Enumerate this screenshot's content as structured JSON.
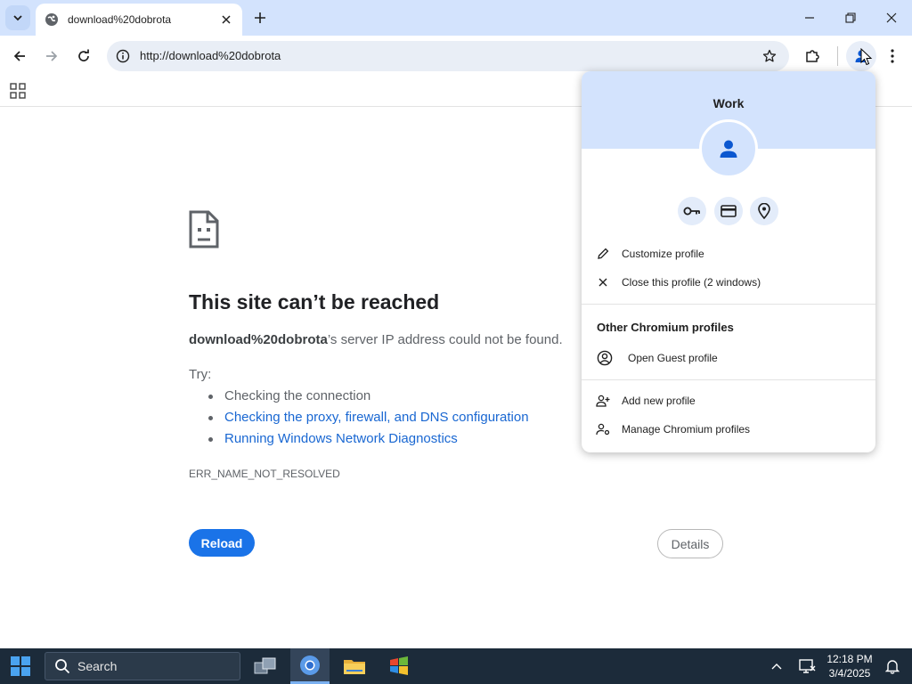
{
  "browser": {
    "tab": {
      "title": "download%20dobrota"
    },
    "omnibox": {
      "url": "http://download%20dobrota"
    }
  },
  "error_page": {
    "title": "This site can’t be reached",
    "host": "download%20dobrota",
    "description_suffix": "’s server IP address could not be found.",
    "try_label": "Try:",
    "suggestions": [
      "Checking the connection",
      "Checking the proxy, firewall, and DNS configuration",
      "Running Windows Network Diagnostics"
    ],
    "error_code": "ERR_NAME_NOT_RESOLVED",
    "reload_label": "Reload",
    "details_label": "Details"
  },
  "profile_menu": {
    "profile_name": "Work",
    "customize_label": "Customize profile",
    "close_label": "Close this profile (2 windows)",
    "other_section": "Other Chromium profiles",
    "guest_label": "Open Guest profile",
    "add_label": "Add new profile",
    "manage_label": "Manage Chromium profiles",
    "quick_icons": [
      "key-icon",
      "credit-card-icon",
      "location-pin-icon"
    ]
  },
  "taskbar": {
    "search_label": "Search",
    "time": "12:18 PM",
    "date": "3/4/2025"
  },
  "colors": {
    "accent": "#1a73e8",
    "tabstrip": "#d3e3fd",
    "link": "#1967d2",
    "taskbar": "#1c2b3a"
  }
}
